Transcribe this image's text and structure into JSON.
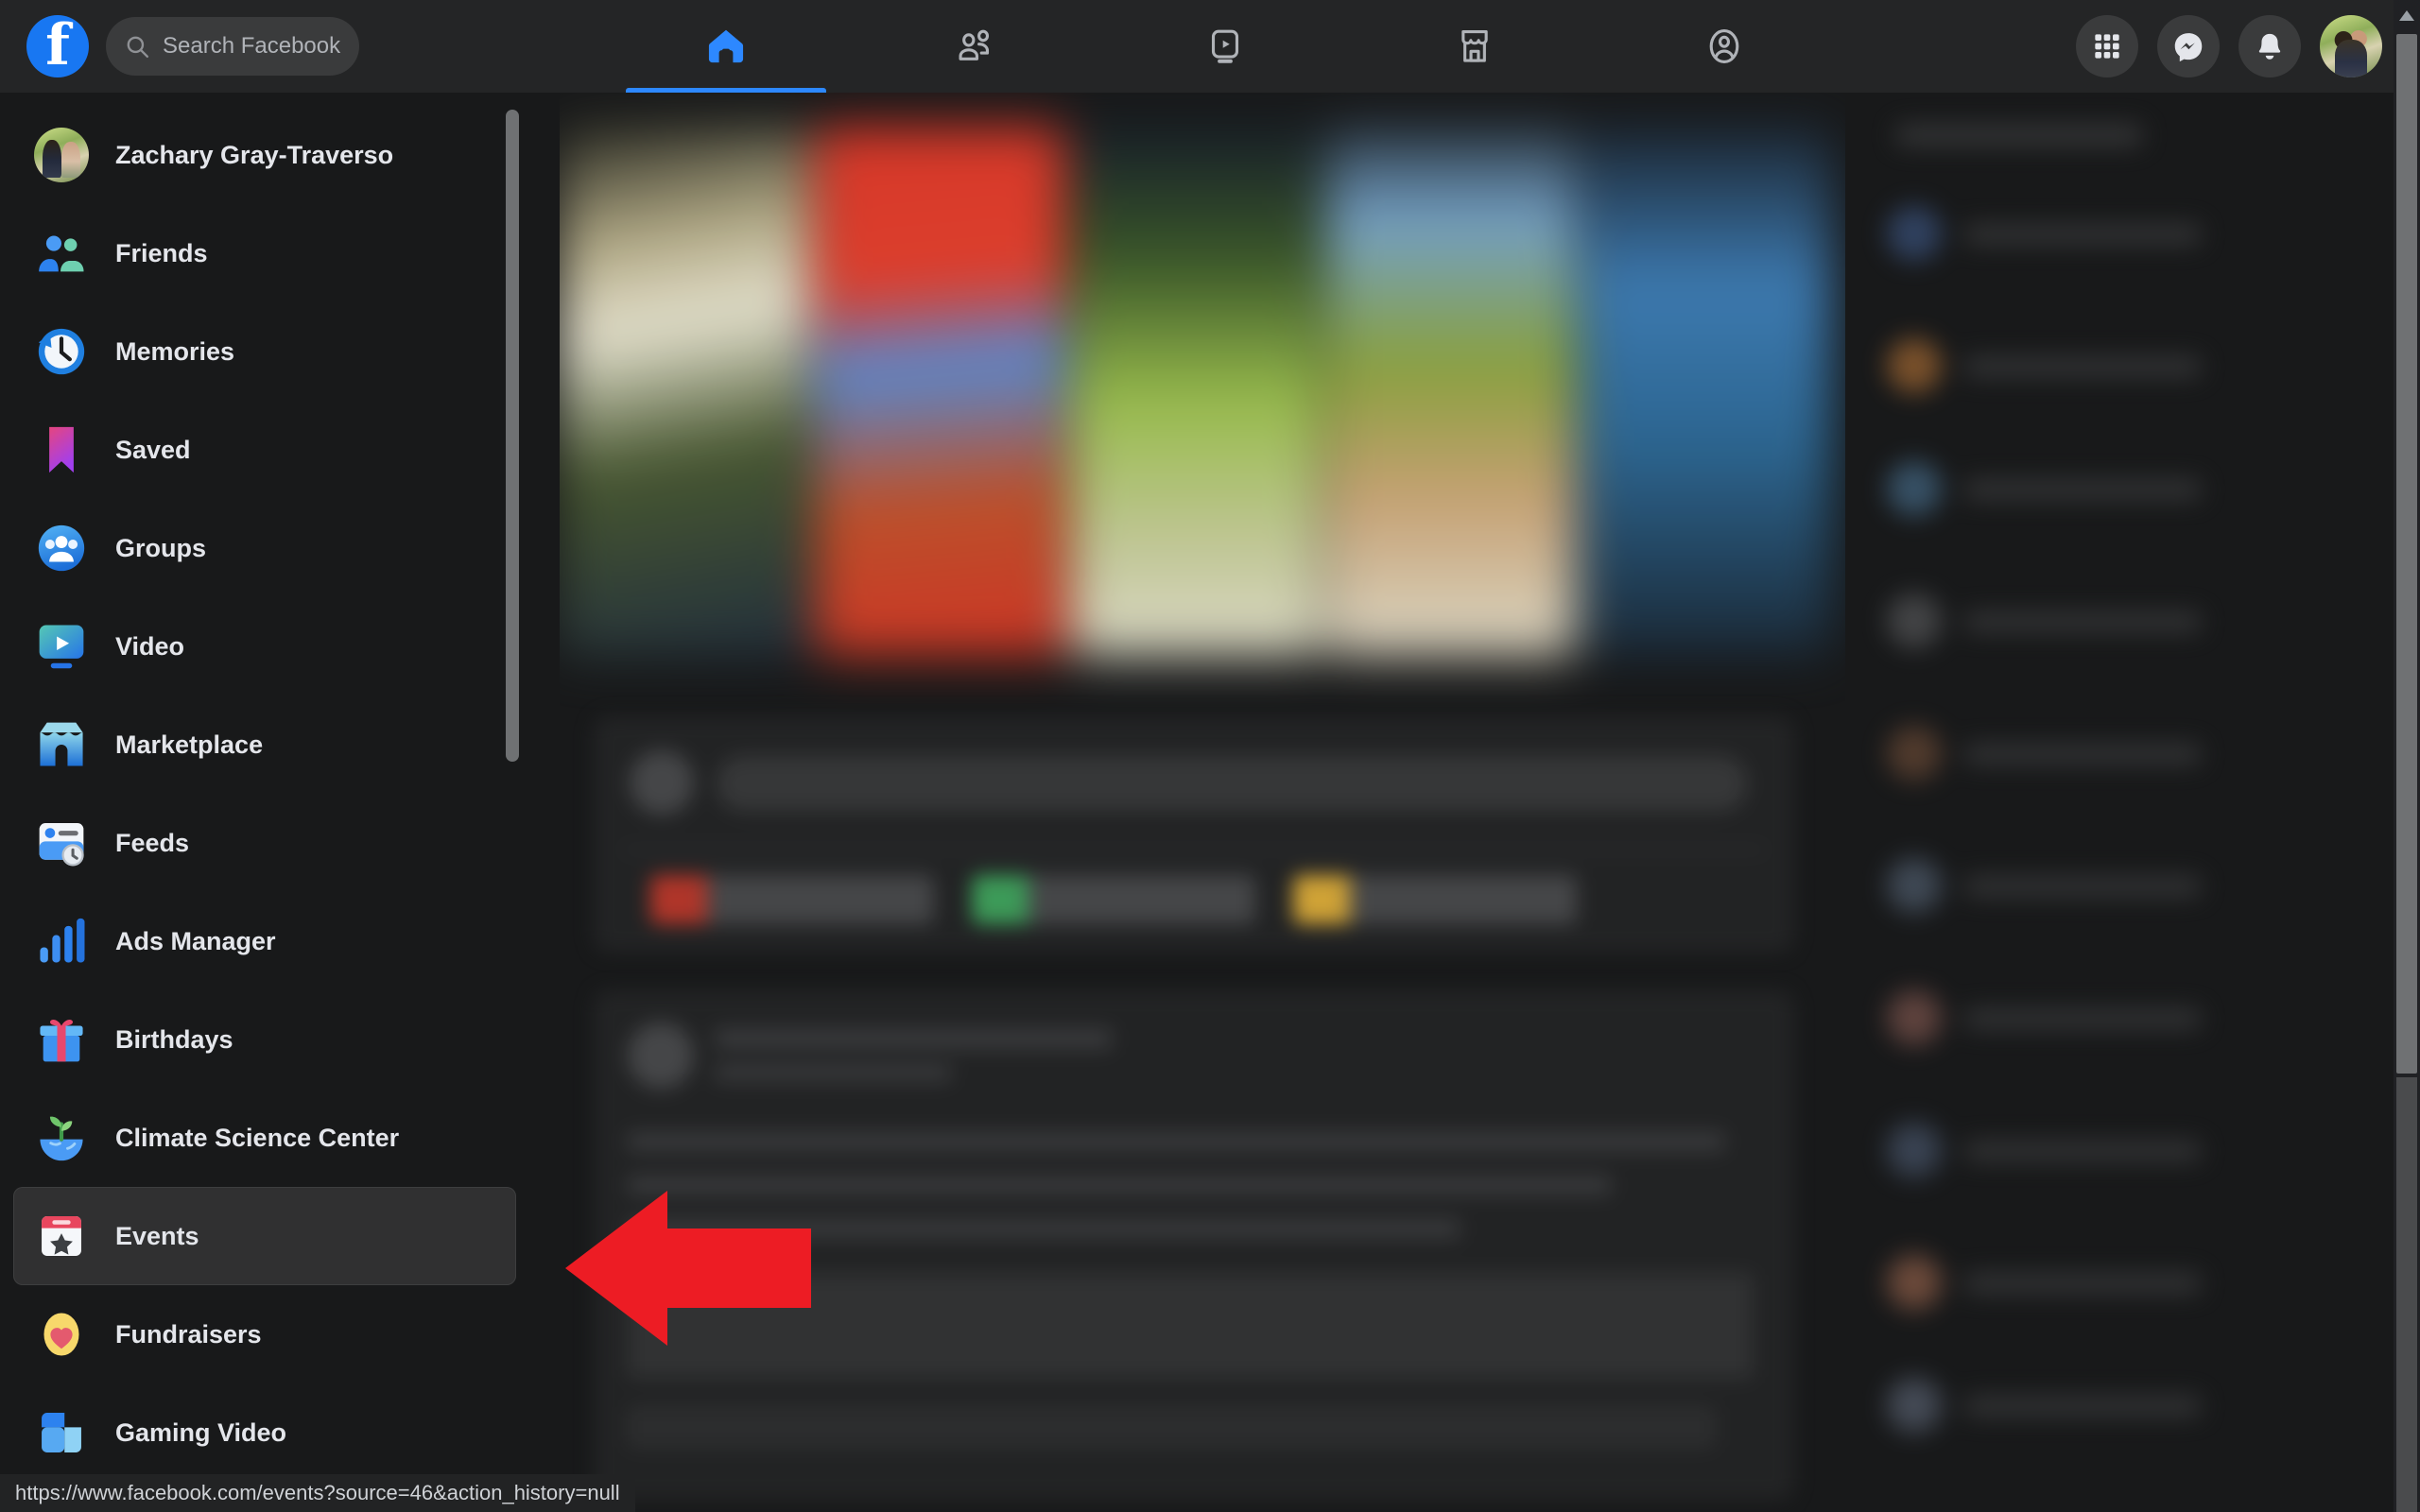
{
  "topbar": {
    "logo_label": "facebook-logo",
    "search": {
      "placeholder": "Search Facebook",
      "value": "",
      "icon": "search-icon"
    },
    "nav": [
      {
        "id": "home",
        "label": "Home",
        "icon": "home-icon",
        "active": true
      },
      {
        "id": "friends",
        "label": "Friends",
        "icon": "friends-icon",
        "active": false
      },
      {
        "id": "video",
        "label": "Video",
        "icon": "video-icon",
        "active": false
      },
      {
        "id": "marketplace",
        "label": "Marketplace",
        "icon": "marketplace-icon",
        "active": false
      },
      {
        "id": "groups",
        "label": "Groups",
        "icon": "groups-icon",
        "active": false
      }
    ],
    "actions": [
      {
        "id": "menu",
        "label": "Menu",
        "icon": "grid-menu-icon"
      },
      {
        "id": "messenger",
        "label": "Messenger",
        "icon": "messenger-icon"
      },
      {
        "id": "notifications",
        "label": "Notifications",
        "icon": "bell-icon"
      },
      {
        "id": "account",
        "label": "Your profile",
        "icon": "avatar-icon"
      }
    ]
  },
  "sidebar": {
    "items": [
      {
        "label": "Zachary Gray-Traverso",
        "icon": "profile-avatar",
        "selected": false
      },
      {
        "label": "Friends",
        "icon": "friends-color-icon",
        "selected": false
      },
      {
        "label": "Memories",
        "icon": "memories-clock-icon",
        "selected": false
      },
      {
        "label": "Saved",
        "icon": "saved-bookmark-icon",
        "selected": false
      },
      {
        "label": "Groups",
        "icon": "groups-color-icon",
        "selected": false
      },
      {
        "label": "Video",
        "icon": "video-play-icon",
        "selected": false
      },
      {
        "label": "Marketplace",
        "icon": "marketplace-shop-icon",
        "selected": false
      },
      {
        "label": "Feeds",
        "icon": "feeds-icon",
        "selected": false
      },
      {
        "label": "Ads Manager",
        "icon": "ads-bars-icon",
        "selected": false
      },
      {
        "label": "Birthdays",
        "icon": "birthday-gift-icon",
        "selected": false
      },
      {
        "label": "Climate Science Center",
        "icon": "climate-sprout-icon",
        "selected": false
      },
      {
        "label": "Events",
        "icon": "events-calendar-star-icon",
        "selected": true
      },
      {
        "label": "Fundraisers",
        "icon": "fundraisers-heart-icon",
        "selected": false
      },
      {
        "label": "Gaming Video",
        "icon": "gaming-video-icon",
        "selected": false
      }
    ]
  },
  "annotation": {
    "type": "arrow",
    "direction": "left",
    "color": "#ed1c24",
    "points_to": "Events"
  },
  "statusbar": {
    "url": "https://www.facebook.com/events?source=46&action_history=null"
  },
  "colors": {
    "brand": "#1877f2",
    "active_tab": "#2d88ff",
    "page_bg": "#18191a",
    "chrome_bg": "#242526",
    "surface": "#3a3b3c",
    "text_primary": "#e4e6eb",
    "text_secondary": "#b0b3b8",
    "annotation_red": "#ed1c24"
  }
}
